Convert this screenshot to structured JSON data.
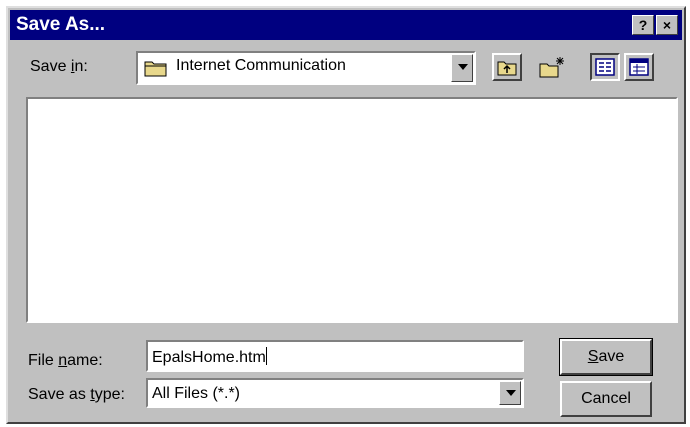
{
  "window": {
    "title": "Save As...",
    "help_label": "?",
    "close_label": "×"
  },
  "save_in": {
    "label_pre": "Save ",
    "label_accel": "i",
    "label_post": "n:",
    "value": "Internet Communication",
    "icon": "folder-icon"
  },
  "toolbar": {
    "up_icon": "up-one-level-icon",
    "new_folder_icon": "new-folder-icon",
    "list_icon": "list-view-icon",
    "details_icon": "details-view-icon"
  },
  "file_list": {
    "items": []
  },
  "file_name": {
    "label_pre": "File ",
    "label_accel": "n",
    "label_post": "ame:",
    "value": "EpalsHome.htm"
  },
  "save_as_type": {
    "label_pre": "Save as ",
    "label_accel": "t",
    "label_post": "ype:",
    "value": "All Files (*.*)"
  },
  "buttons": {
    "save_accel": "S",
    "save_rest": "ave",
    "cancel": "Cancel"
  }
}
